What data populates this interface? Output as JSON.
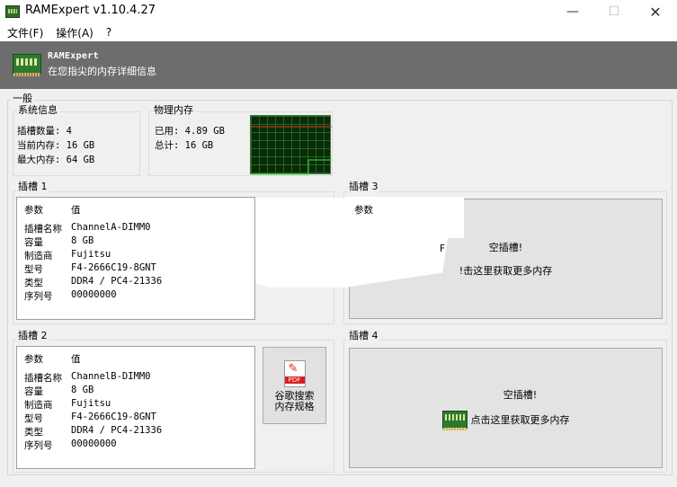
{
  "window": {
    "title": "RAMExpert v1.10.4.27",
    "minimize": "—",
    "maximize": "☐",
    "close": "✕"
  },
  "menu": [
    "文件(F)",
    "操作(A)",
    "?"
  ],
  "banner": {
    "title": "RAMExpert",
    "subtitle": "在您指尖的内存详细信息",
    "icon": "ram-module-icon"
  },
  "general": {
    "label": "一般",
    "system_info": {
      "label": "系统信息",
      "slots": "插槽数量: 4",
      "current": "当前内存: 16 GB",
      "max": "最大内存: 64 GB"
    },
    "physical_memory": {
      "label": "物理内存",
      "used": "已用: 4.89 GB",
      "total": "总计: 16 GB",
      "usage_fraction": 0.306
    }
  },
  "slots": {
    "slot1": {
      "label": "插槽 1",
      "header_key": "参数",
      "header_val": "值",
      "rows": [
        {
          "k": "插槽名称",
          "v": "ChannelA-DIMM0"
        },
        {
          "k": "容量",
          "v": "8 GB"
        },
        {
          "k": "制造商",
          "v": "Fujitsu"
        },
        {
          "k": "型号",
          "v": "F4-2666C19-8GNT"
        },
        {
          "k": "类型",
          "v": "DDR4 / PC4-21336"
        },
        {
          "k": "序列号",
          "v": "00000000"
        }
      ]
    },
    "slot2": {
      "label": "插槽 2",
      "header_key": "参数",
      "header_val": "值",
      "rows": [
        {
          "k": "插槽名称",
          "v": "ChannelB-DIMM0"
        },
        {
          "k": "容量",
          "v": "8 GB"
        },
        {
          "k": "制造商",
          "v": "Fujitsu"
        },
        {
          "k": "型号",
          "v": "F4-2666C19-8GNT"
        },
        {
          "k": "类型",
          "v": "DDR4 / PC4-21336"
        },
        {
          "k": "序列号",
          "v": "00000000"
        }
      ]
    },
    "slot3": {
      "label": "插槽 3",
      "header_key": "参数",
      "empty_title": "空插槽!",
      "empty_link": "!击这里获取更多内存",
      "stray": "F"
    },
    "slot4": {
      "label": "插槽 4",
      "empty_title": "空插槽!",
      "empty_link": "点击这里获取更多内存"
    }
  },
  "pdf_button": {
    "icon_tag": "PDF",
    "line1": "谷歌搜索",
    "line2": "内存规格"
  },
  "colors": {
    "banner_bg": "#6d6d6d",
    "graph_bg": "#0a2a0a",
    "graph_grid": "#1f6a1f",
    "graph_total_line": "#e03030",
    "graph_used_line": "#40e040"
  }
}
